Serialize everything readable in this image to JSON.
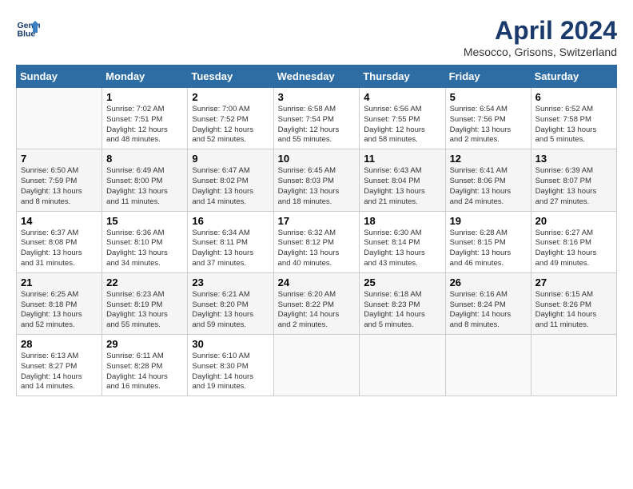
{
  "app": {
    "name": "GeneralBlue",
    "logo_line1": "General",
    "logo_line2": "Blue"
  },
  "header": {
    "title": "April 2024",
    "subtitle": "Mesocco, Grisons, Switzerland"
  },
  "weekdays": [
    "Sunday",
    "Monday",
    "Tuesday",
    "Wednesday",
    "Thursday",
    "Friday",
    "Saturday"
  ],
  "weeks": [
    [
      {
        "day": "",
        "info": ""
      },
      {
        "day": "1",
        "info": "Sunrise: 7:02 AM\nSunset: 7:51 PM\nDaylight: 12 hours\nand 48 minutes."
      },
      {
        "day": "2",
        "info": "Sunrise: 7:00 AM\nSunset: 7:52 PM\nDaylight: 12 hours\nand 52 minutes."
      },
      {
        "day": "3",
        "info": "Sunrise: 6:58 AM\nSunset: 7:54 PM\nDaylight: 12 hours\nand 55 minutes."
      },
      {
        "day": "4",
        "info": "Sunrise: 6:56 AM\nSunset: 7:55 PM\nDaylight: 12 hours\nand 58 minutes."
      },
      {
        "day": "5",
        "info": "Sunrise: 6:54 AM\nSunset: 7:56 PM\nDaylight: 13 hours\nand 2 minutes."
      },
      {
        "day": "6",
        "info": "Sunrise: 6:52 AM\nSunset: 7:58 PM\nDaylight: 13 hours\nand 5 minutes."
      }
    ],
    [
      {
        "day": "7",
        "info": "Sunrise: 6:50 AM\nSunset: 7:59 PM\nDaylight: 13 hours\nand 8 minutes."
      },
      {
        "day": "8",
        "info": "Sunrise: 6:49 AM\nSunset: 8:00 PM\nDaylight: 13 hours\nand 11 minutes."
      },
      {
        "day": "9",
        "info": "Sunrise: 6:47 AM\nSunset: 8:02 PM\nDaylight: 13 hours\nand 14 minutes."
      },
      {
        "day": "10",
        "info": "Sunrise: 6:45 AM\nSunset: 8:03 PM\nDaylight: 13 hours\nand 18 minutes."
      },
      {
        "day": "11",
        "info": "Sunrise: 6:43 AM\nSunset: 8:04 PM\nDaylight: 13 hours\nand 21 minutes."
      },
      {
        "day": "12",
        "info": "Sunrise: 6:41 AM\nSunset: 8:06 PM\nDaylight: 13 hours\nand 24 minutes."
      },
      {
        "day": "13",
        "info": "Sunrise: 6:39 AM\nSunset: 8:07 PM\nDaylight: 13 hours\nand 27 minutes."
      }
    ],
    [
      {
        "day": "14",
        "info": "Sunrise: 6:37 AM\nSunset: 8:08 PM\nDaylight: 13 hours\nand 31 minutes."
      },
      {
        "day": "15",
        "info": "Sunrise: 6:36 AM\nSunset: 8:10 PM\nDaylight: 13 hours\nand 34 minutes."
      },
      {
        "day": "16",
        "info": "Sunrise: 6:34 AM\nSunset: 8:11 PM\nDaylight: 13 hours\nand 37 minutes."
      },
      {
        "day": "17",
        "info": "Sunrise: 6:32 AM\nSunset: 8:12 PM\nDaylight: 13 hours\nand 40 minutes."
      },
      {
        "day": "18",
        "info": "Sunrise: 6:30 AM\nSunset: 8:14 PM\nDaylight: 13 hours\nand 43 minutes."
      },
      {
        "day": "19",
        "info": "Sunrise: 6:28 AM\nSunset: 8:15 PM\nDaylight: 13 hours\nand 46 minutes."
      },
      {
        "day": "20",
        "info": "Sunrise: 6:27 AM\nSunset: 8:16 PM\nDaylight: 13 hours\nand 49 minutes."
      }
    ],
    [
      {
        "day": "21",
        "info": "Sunrise: 6:25 AM\nSunset: 8:18 PM\nDaylight: 13 hours\nand 52 minutes."
      },
      {
        "day": "22",
        "info": "Sunrise: 6:23 AM\nSunset: 8:19 PM\nDaylight: 13 hours\nand 55 minutes."
      },
      {
        "day": "23",
        "info": "Sunrise: 6:21 AM\nSunset: 8:20 PM\nDaylight: 13 hours\nand 59 minutes."
      },
      {
        "day": "24",
        "info": "Sunrise: 6:20 AM\nSunset: 8:22 PM\nDaylight: 14 hours\nand 2 minutes."
      },
      {
        "day": "25",
        "info": "Sunrise: 6:18 AM\nSunset: 8:23 PM\nDaylight: 14 hours\nand 5 minutes."
      },
      {
        "day": "26",
        "info": "Sunrise: 6:16 AM\nSunset: 8:24 PM\nDaylight: 14 hours\nand 8 minutes."
      },
      {
        "day": "27",
        "info": "Sunrise: 6:15 AM\nSunset: 8:26 PM\nDaylight: 14 hours\nand 11 minutes."
      }
    ],
    [
      {
        "day": "28",
        "info": "Sunrise: 6:13 AM\nSunset: 8:27 PM\nDaylight: 14 hours\nand 14 minutes."
      },
      {
        "day": "29",
        "info": "Sunrise: 6:11 AM\nSunset: 8:28 PM\nDaylight: 14 hours\nand 16 minutes."
      },
      {
        "day": "30",
        "info": "Sunrise: 6:10 AM\nSunset: 8:30 PM\nDaylight: 14 hours\nand 19 minutes."
      },
      {
        "day": "",
        "info": ""
      },
      {
        "day": "",
        "info": ""
      },
      {
        "day": "",
        "info": ""
      },
      {
        "day": "",
        "info": ""
      }
    ]
  ]
}
